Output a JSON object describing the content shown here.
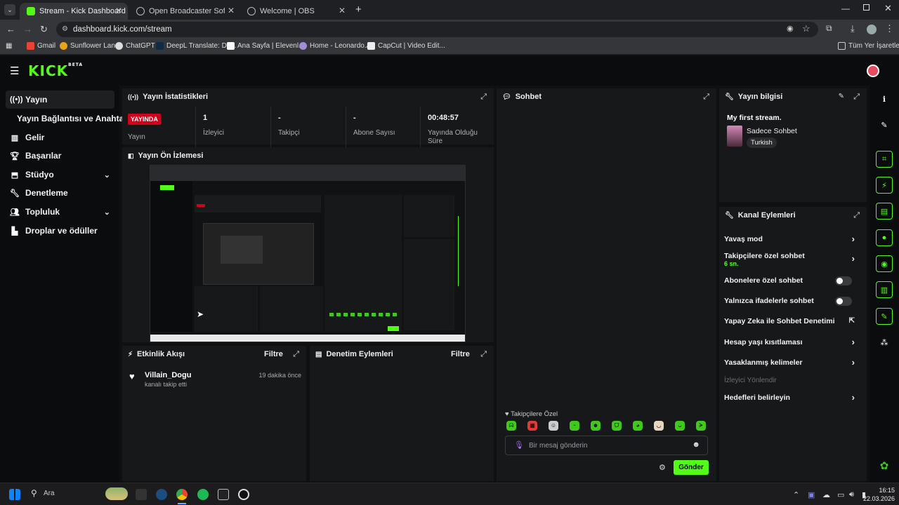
{
  "browser": {
    "tabs": [
      {
        "label": "Stream - Kick Dashboard",
        "active": true
      },
      {
        "label": "Open Broadcaster Software | Ol",
        "active": false
      },
      {
        "label": "Welcome | OBS",
        "active": false
      }
    ],
    "url": "dashboard.kick.com/stream",
    "bookmarks": [
      "Gmail",
      "Sunflower Land",
      "ChatGPT",
      "DeepL Translate: Dü...",
      "Ana Sayfa | Elevenl...",
      "Home - Leonardo.Ai",
      "CapCut | Video Edit..."
    ],
    "all_bookmarks": "Tüm Yer İşaretleri"
  },
  "kick": {
    "logo": "KICK",
    "logo_sup": "BETA"
  },
  "sidebar": {
    "items": [
      {
        "label": "Yayın",
        "icon": "broadcast-icon"
      },
      {
        "label": "Yayın Bağlantısı ve Anahtarı",
        "icon": ""
      },
      {
        "label": "Gelir",
        "icon": "chart-icon"
      },
      {
        "label": "Başarılar",
        "icon": "trophy-icon"
      },
      {
        "label": "Stüdyo",
        "icon": "studio-icon"
      },
      {
        "label": "Denetleme",
        "icon": "wrench-icon"
      },
      {
        "label": "Topluluk",
        "icon": "community-icon"
      },
      {
        "label": "Droplar ve ödüller",
        "icon": "gift-icon"
      }
    ]
  },
  "stats": {
    "title": "Yayın İstatistikleri",
    "live_badge": "YAYINDA",
    "live_label": "Yayın",
    "viewers_value": "1",
    "viewers_label": "İzleyici",
    "followers_value": "-",
    "followers_label": "Takipçi",
    "subs_value": "-",
    "subs_label": "Abone Sayısı",
    "duration_value": "00:48:57",
    "duration_label": "Yayında Olduğu Süre"
  },
  "preview": {
    "title": "Yayın Ön İzlemesi"
  },
  "activity": {
    "title": "Etkinlik Akışı",
    "filter": "Filtre",
    "user": "Villain_Dogu",
    "action": "kanalı takip etti",
    "time": "19 dakika önce"
  },
  "modactions": {
    "title": "Denetim Eylemleri",
    "filter": "Filtre"
  },
  "chat": {
    "title": "Sohbet",
    "followers_only": "Takipçilere Özel",
    "placeholder": "Bir mesaj gönderin",
    "send": "Gönder"
  },
  "streaminfo": {
    "title": "Yayın bilgisi",
    "stream_title": "My first stream.",
    "category": "Sadece Sohbet",
    "language": "Turkish"
  },
  "channel_actions": {
    "title": "Kanal Eylemleri",
    "slow_mode": "Yavaş mod",
    "followers_chat": "Takipçilere özel sohbet",
    "followers_chat_value": "6 sn.",
    "subs_chat": "Abonelere özel sohbet",
    "emote_chat": "Yalnızca ifadelerle sohbet",
    "ai_mod": "Yapay Zeka ile Sohbet Denetimi",
    "age_restrict": "Hesap yaşı kısıtlaması",
    "banned_words": "Yasaklanmış kelimeler",
    "redirect": "İzleyici Yönlendir",
    "goals": "Hedefleri belirleyin"
  },
  "taskbar": {
    "search": "Ara",
    "time": "16:15",
    "date": "22.03.2026"
  },
  "colors": {
    "kick_green": "#53fc18",
    "live_red": "#d0021b"
  }
}
